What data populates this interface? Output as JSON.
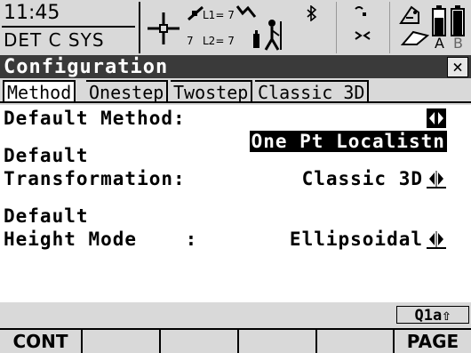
{
  "status": {
    "time": "11:45",
    "coord_system": "DET C SYS",
    "sat_l1": "L1= 7",
    "sat_l2": "L2= 7",
    "sat_count": "7",
    "memory_labels": [
      "A",
      "B"
    ],
    "icons": [
      "satellite-crosshair-icon",
      "satellite-signal-icon",
      "antenna-icon",
      "surveyor-icon",
      "bluetooth-icon",
      "radio-link-icon",
      "memory-card-icon",
      "battery-icon"
    ]
  },
  "dialog": {
    "title": "Configuration",
    "close_label": "×"
  },
  "tabs": [
    {
      "label": "Method",
      "active": true
    },
    {
      "label": "Onestep",
      "active": false
    },
    {
      "label": "Twostep",
      "active": false
    },
    {
      "label": "Classic 3D",
      "active": false
    }
  ],
  "fields": {
    "default_method": {
      "label": "Default Method:",
      "value": "One Pt Localistn"
    },
    "default_transformation": {
      "label_line1": "Default",
      "label_line2": "Transformation:",
      "value": "Classic 3D"
    },
    "default_height_mode": {
      "label_line1": "Default",
      "label_line2": "Height Mode    :",
      "value": "Ellipsoidal"
    }
  },
  "indicator": {
    "text": "Q1a⇧"
  },
  "softkeys": [
    "CONT",
    "",
    "",
    "",
    "",
    "PAGE"
  ]
}
